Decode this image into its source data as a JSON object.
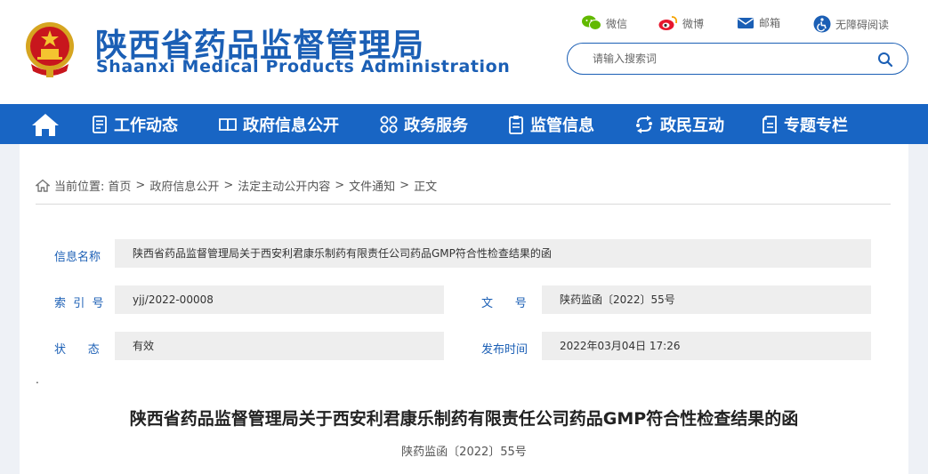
{
  "header": {
    "title_cn": "陕西省药品监督管理局",
    "title_en": "Shaanxi Medical Products Administration",
    "emblem_icon": "national-emblem-icon"
  },
  "tools": [
    {
      "label": "微信",
      "icon": "wechat-icon"
    },
    {
      "label": "微博",
      "icon": "weibo-icon"
    },
    {
      "label": "邮箱",
      "icon": "mail-icon"
    },
    {
      "label": "无障碍阅读",
      "icon": "accessibility-icon"
    }
  ],
  "search": {
    "placeholder": "请输入搜索词",
    "icon": "search-icon"
  },
  "nav": {
    "home_icon": "home-icon",
    "items": [
      {
        "label": "工作动态",
        "icon": "document-list-icon"
      },
      {
        "label": "政府信息公开",
        "icon": "open-book-icon"
      },
      {
        "label": "政务服务",
        "icon": "grid-circles-icon"
      },
      {
        "label": "监管信息",
        "icon": "clipboard-icon"
      },
      {
        "label": "政民互动",
        "icon": "interaction-icon"
      },
      {
        "label": "专题专栏",
        "icon": "special-topic-icon"
      }
    ]
  },
  "breadcrumb": {
    "prefix": "当前位置:",
    "items": [
      "首页",
      "政府信息公开",
      "法定主动公开内容",
      "文件通知",
      "正文"
    ],
    "separator": ">"
  },
  "meta": {
    "info_name_label": "信息名称",
    "info_name_value": "陕西省药品监督管理局关于西安利君康乐制药有限责任公司药品GMP符合性检查结果的函",
    "index_label": "索  引  号",
    "index_value": "yjj/2022-00008",
    "doc_no_label": "文      号",
    "doc_no_value": "陕药监函〔2022〕55号",
    "status_label": "状      态",
    "status_value": "有效",
    "date_label": "发布时间",
    "date_value": "2022年03月04日 17:26"
  },
  "stray_dot": ".",
  "document": {
    "title": "陕西省药品监督管理局关于西安利君康乐制药有限责任公司药品GMP符合性检查结果的函",
    "number": "陕药监函〔2022〕55号"
  },
  "colors": {
    "brand_blue": "#1b5fb5",
    "nav_blue": "#1865c4",
    "page_bg": "#eef1f6"
  }
}
